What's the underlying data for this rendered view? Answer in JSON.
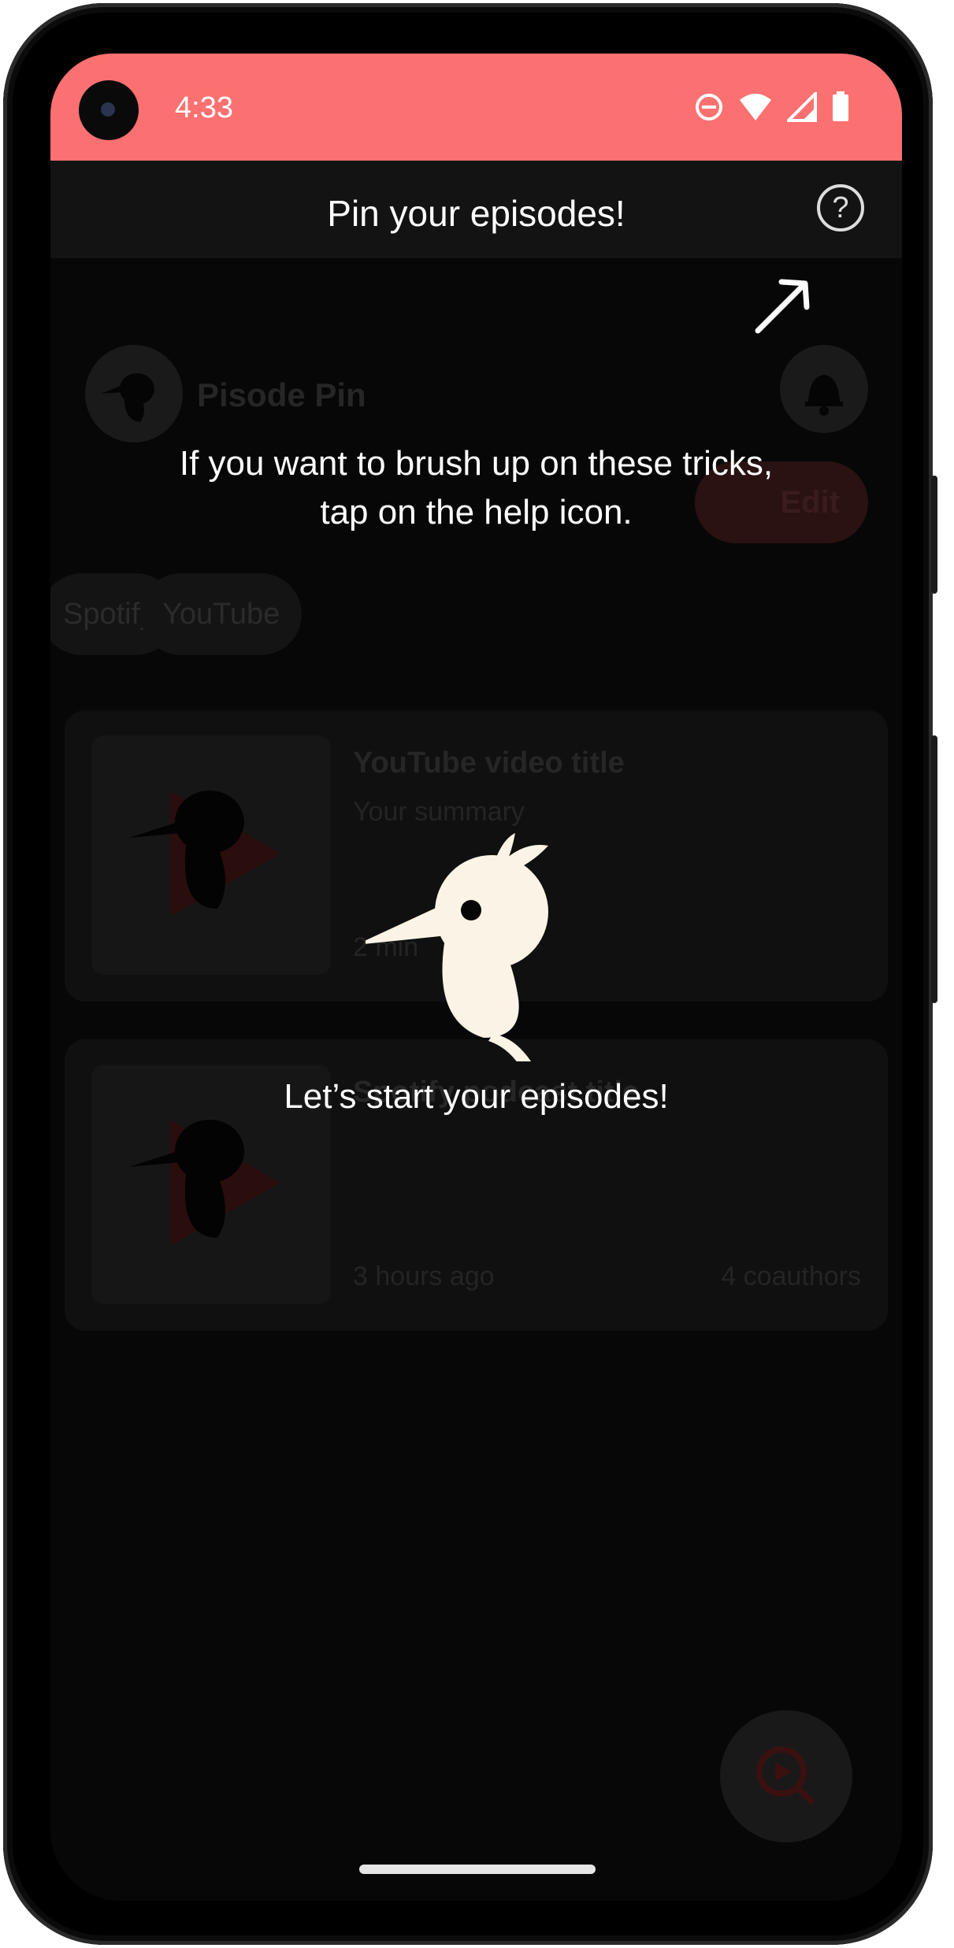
{
  "status_bar": {
    "time": "4:33",
    "color": "#fb7070"
  },
  "header": {
    "title": "Pin your episodes!",
    "help_icon": "help-circle-icon"
  },
  "app": {
    "name": "Pisode Pin",
    "edit_label": "Edit",
    "chips": [
      "Spotify",
      "YouTube"
    ],
    "cards": [
      {
        "title": "YouTube video title",
        "summary": "Your summary",
        "time": "2 min",
        "coauthors": ""
      },
      {
        "title": "Spotify podcast title",
        "summary": "",
        "time": "3 hours ago",
        "coauthors": "4 coauthors"
      }
    ]
  },
  "coach": {
    "tip_line1": "If you want to brush up on these tricks,",
    "tip_line2": "tap on the help icon.",
    "welcome": "Let’s start your episodes!"
  },
  "colors": {
    "accent": "#fb7070",
    "mascot": "#fbf4e6"
  }
}
